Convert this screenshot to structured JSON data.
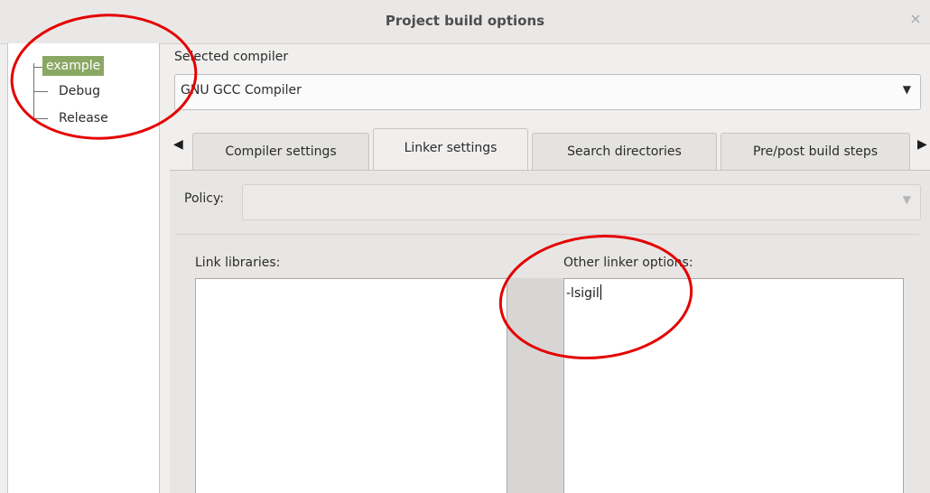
{
  "window": {
    "title": "Project build options",
    "close_glyph": "×"
  },
  "tree": {
    "nodes": [
      {
        "label": "example",
        "selected": true
      },
      {
        "label": "Debug",
        "selected": false
      },
      {
        "label": "Release",
        "selected": false
      }
    ]
  },
  "compiler": {
    "label": "Selected compiler",
    "value": "GNU GCC Compiler",
    "arrow_glyph": "▼"
  },
  "tabs": {
    "scroll_left_glyph": "◀",
    "scroll_right_glyph": "▶",
    "items": [
      {
        "label": "Compiler settings",
        "active": false
      },
      {
        "label": "Linker settings",
        "active": true
      },
      {
        "label": "Search directories",
        "active": false
      },
      {
        "label": "Pre/post build steps",
        "active": false
      }
    ]
  },
  "linker": {
    "policy_label": "Policy:",
    "policy_value": "",
    "policy_arrow_glyph": "▼",
    "link_libraries_label": "Link libraries:",
    "other_options_label": "Other linker options:",
    "other_options_value": "-lsigil"
  },
  "colors": {
    "selection": "#8aa864",
    "annotation": "#e50000"
  },
  "icons": {
    "close": "close-icon",
    "dropdown": "chevron-down-icon",
    "tab_scroll_left": "triangle-left-icon",
    "tab_scroll_right": "triangle-right-icon"
  }
}
